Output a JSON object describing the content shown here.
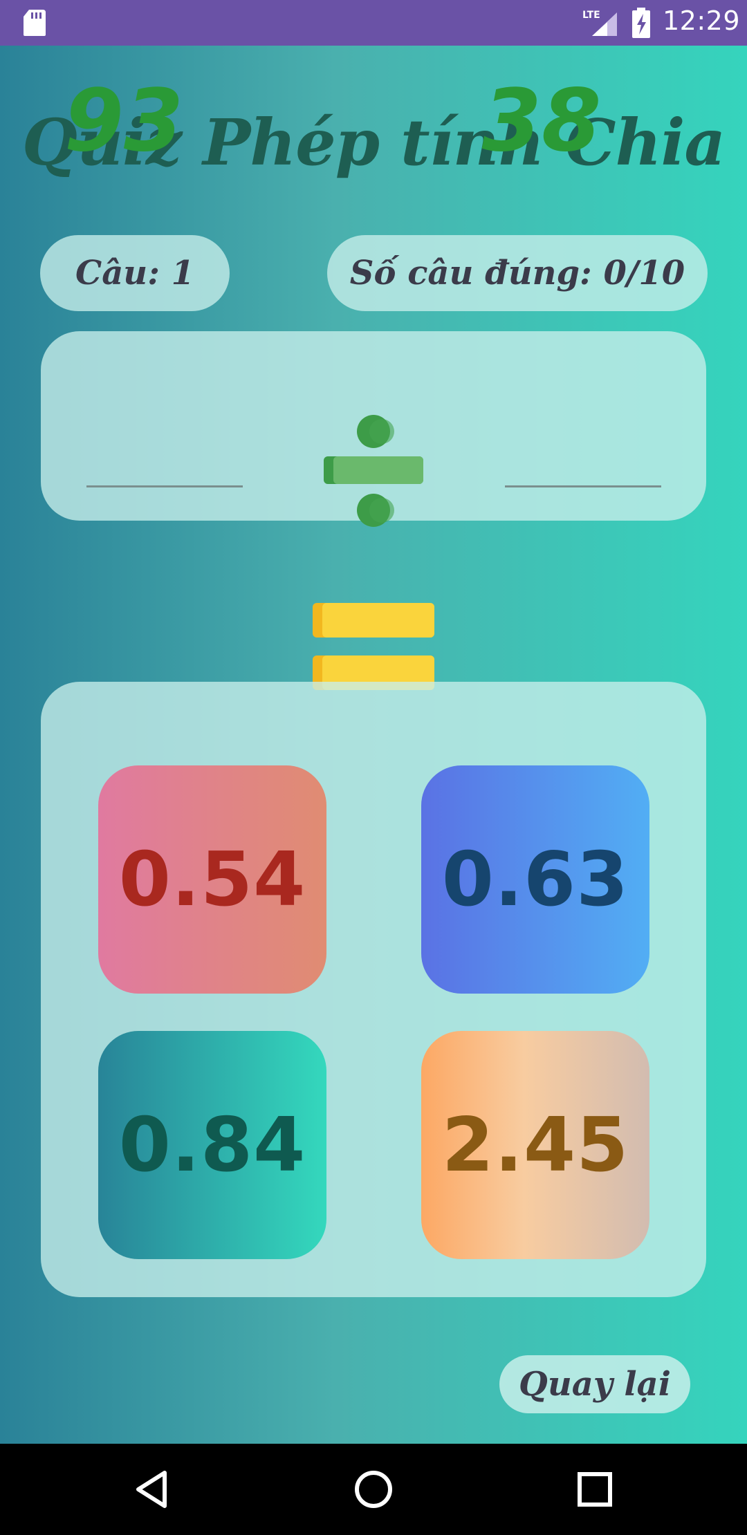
{
  "status_bar": {
    "network": "LTE",
    "time": "12:29"
  },
  "app": {
    "title": "Quiz Phép tính Chia",
    "question_label": "Câu: 1",
    "score_label": "Số câu đúng: 0/10",
    "problem": {
      "left_operand": "93",
      "operator": "divide",
      "right_operand": "38"
    },
    "answers": [
      "0.54",
      "0.63",
      "0.84",
      "2.45"
    ],
    "back_label": "Quay lại"
  },
  "colors": {
    "status_bar": "#6a52a6",
    "title": "#1e5e52",
    "operand": "#2a9a36",
    "divide_symbol": "#3d9c48",
    "equals_symbol": "#fad43c"
  },
  "icons": {
    "status_left": "sd-card-icon",
    "status_signal": "signal-icon",
    "status_battery": "battery-charging-icon",
    "operator": "divide-icon",
    "equals": "equals-icon",
    "nav": [
      "back-triangle-icon",
      "home-circle-icon",
      "recent-square-icon"
    ]
  }
}
